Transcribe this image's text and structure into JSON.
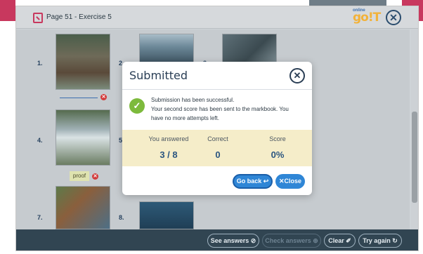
{
  "window": {
    "title": "Page 51 - Exercise 5",
    "close_icon": "close-icon"
  },
  "brand": {
    "logo_text": "go!T",
    "logo_small": "online"
  },
  "exercise": {
    "numbers": [
      "1.",
      "2.",
      "3.",
      "4.",
      "5",
      "7.",
      "8."
    ],
    "answer_4": "proof"
  },
  "modal": {
    "title": "Submitted",
    "message_line1": "Submission has been successful.",
    "message_line2": "Your second score has been sent to the markbook. You",
    "message_line3": "have no more attempts left.",
    "labels": {
      "answered": "You answered",
      "correct": "Correct",
      "score": "Score"
    },
    "values": {
      "answered": "3 / 8",
      "correct": "0",
      "score": "0%"
    },
    "go_back": "Go back ↩",
    "close": "✕Close"
  },
  "footer": {
    "see_answers": "See answers ⊘",
    "check_answers": "Check answers ⊕",
    "clear": "Clear ✐",
    "try_again": "Try again ↻"
  },
  "colors": {
    "brand_pink": "#c8385e",
    "footer_bg": "#314552",
    "primary_button": "#2f86d6",
    "success_green": "#7dba3c"
  }
}
